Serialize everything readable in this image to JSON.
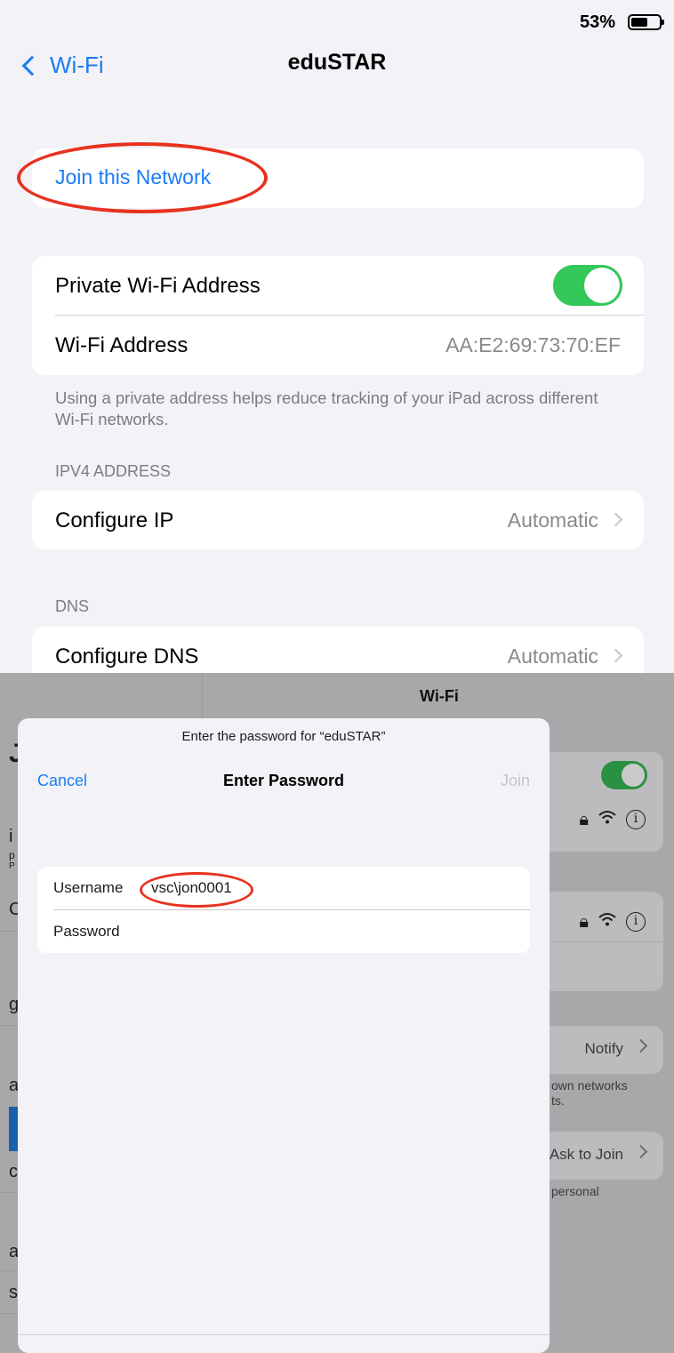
{
  "status_bar": {
    "battery_percent": "53%",
    "battery_level": 0.53
  },
  "nav": {
    "back_label": "Wi-Fi",
    "title": "eduSTAR"
  },
  "join_network": {
    "label": "Join this Network"
  },
  "private_address": {
    "toggle_label": "Private Wi-Fi Address",
    "toggle_on": true,
    "address_label": "Wi-Fi Address",
    "address_value": "AA:E2:69:73:70:EF",
    "footnote": "Using a private address helps reduce tracking of your iPad across different Wi-Fi networks."
  },
  "ipv4": {
    "header": "IPV4 ADDRESS",
    "label": "Configure IP",
    "value": "Automatic"
  },
  "dns": {
    "header": "DNS",
    "label": "Configure DNS",
    "value": "Automatic"
  },
  "background": {
    "title": "Wi-Fi",
    "notify_value": "Notify",
    "known_networks_fragment": "own networks",
    "known_networks_fragment2": "ts.",
    "ask_to_join": "Ask to Join",
    "personal_fragment": "personal",
    "info_glyph": "i",
    "left_fragments": [
      "i",
      "p",
      "P",
      "C",
      "g",
      "a",
      "c",
      "a",
      "s"
    ]
  },
  "password_sheet": {
    "prompt": "Enter the password for “eduSTAR”",
    "cancel_label": "Cancel",
    "title": "Enter Password",
    "join_label": "Join",
    "username_label": "Username",
    "username_value": "vsc\\jon0001",
    "password_label": "Password",
    "password_value": ""
  },
  "colors": {
    "accent": "#1a7cf5",
    "toggle_on": "#34c759",
    "annotation": "#e8311f"
  },
  "icons": [
    "chevron-left-icon",
    "battery-icon",
    "lock-icon",
    "wifi-icon",
    "info-icon",
    "chevron-right-icon"
  ]
}
